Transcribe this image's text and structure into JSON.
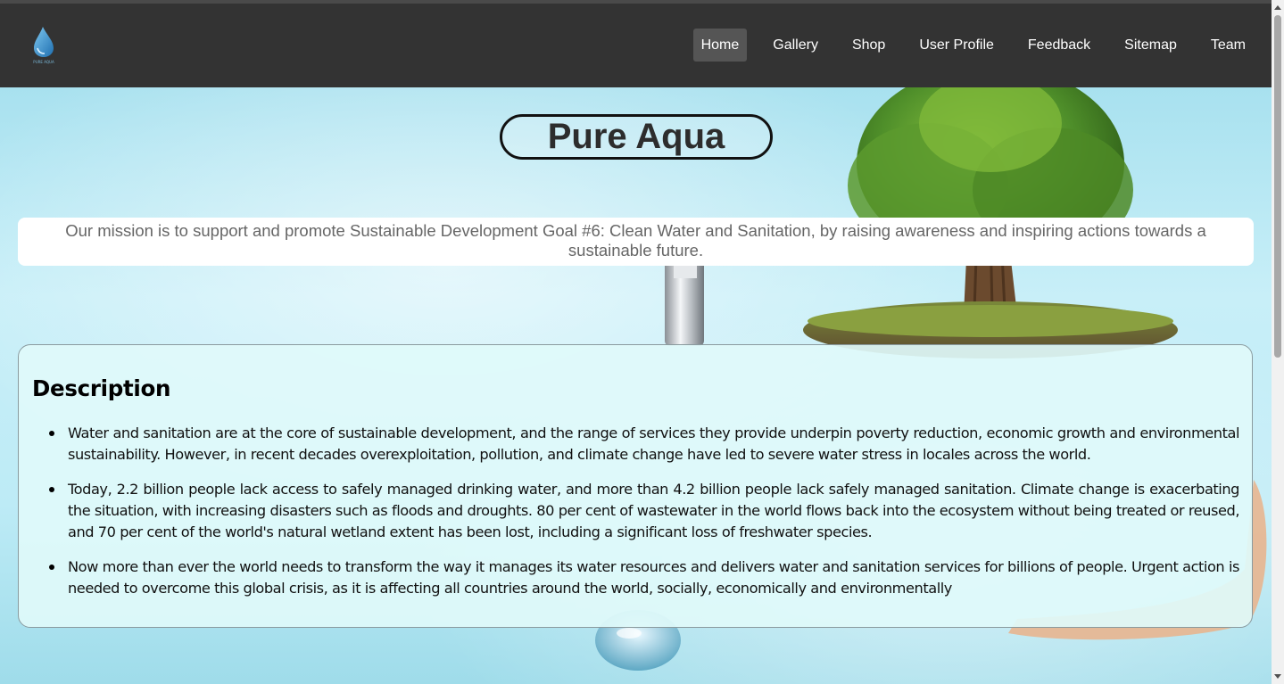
{
  "brand": {
    "logo_icon": "water-drop-logo-icon",
    "logo_text": "PURE AQUA"
  },
  "nav": {
    "items": [
      {
        "label": "Home",
        "active": true
      },
      {
        "label": "Gallery",
        "active": false
      },
      {
        "label": "Shop",
        "active": false
      },
      {
        "label": "User Profile",
        "active": false
      },
      {
        "label": "Feedback",
        "active": false
      },
      {
        "label": "Sitemap",
        "active": false
      },
      {
        "label": "Team",
        "active": false
      }
    ]
  },
  "hero": {
    "title": "Pure Aqua",
    "mission": "Our mission is to support and promote Sustainable Development Goal #6: Clean Water and Sanitation, by raising awareness and inspiring actions towards a sustainable future."
  },
  "description": {
    "heading": "Description",
    "points": [
      "Water and sanitation are at the core of sustainable development, and the range of services they provide underpin poverty reduction, economic growth and environmental sustainability. However, in recent decades overexploitation, pollution, and climate change have led to severe water stress in locales across the world.",
      "Today, 2.2 billion people lack access to safely managed drinking water, and more than 4.2 billion people lack safely managed sanitation. Climate change is exacerbating the situation, with increasing disasters such as floods and droughts. 80 per cent of wastewater in the world flows back into the ecosystem without being treated or reused, and 70 per cent of the world's natural wetland extent has been lost, including a significant loss of freshwater species.",
      "Now more than ever the world needs to transform the way it manages its water resources and delivers water and sanitation services for billions of people. Urgent action is needed to overcome this global crisis, as it is affecting all countries around the world, socially, economically and environmentally"
    ]
  },
  "colors": {
    "navbar": "#333333",
    "nav_active": "#555555",
    "description_bg": "#e0fafa",
    "mission_text": "#666666"
  }
}
